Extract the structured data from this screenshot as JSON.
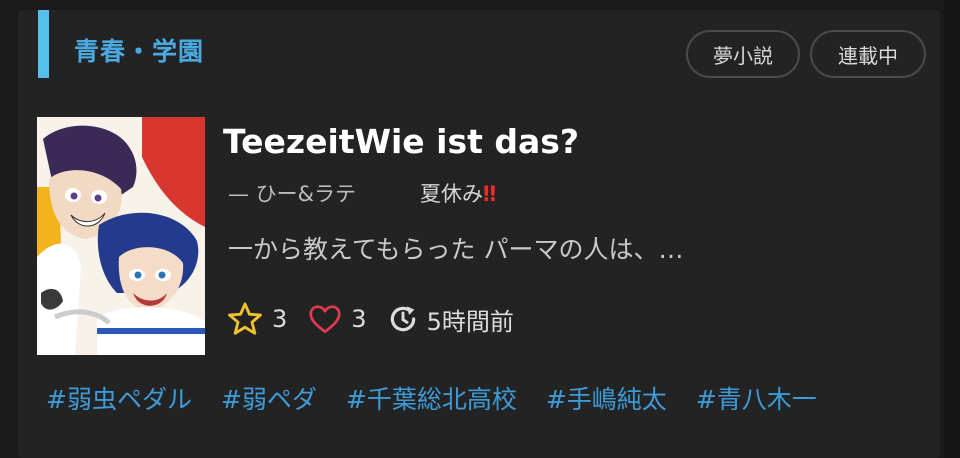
{
  "genre": {
    "label": "青春・学園"
  },
  "badges": {
    "dream": "夢小説",
    "serial": "連載中"
  },
  "story": {
    "title": "TeezeitWie ist das?",
    "author": "— ひー&ラテ",
    "episode": "夏休み",
    "episode_mark": "‼",
    "excerpt": "一から教えてもらった パーマの人は、…"
  },
  "stats": {
    "stars": "3",
    "likes": "3",
    "updated": "5時間前"
  },
  "tags": [
    "#弱虫ペダル",
    "#弱ペダ",
    "#千葉総北高校",
    "#手嶋純太",
    "#青八木一"
  ],
  "colors": {
    "accent_bar": "#56c0ec",
    "tag": "#3d9bd9",
    "star": "#f2c230",
    "heart": "#e23b4e",
    "warning": "#ef2c2c"
  },
  "icons": {
    "star": "star-icon",
    "heart": "heart-icon",
    "clock": "clock-refresh-icon"
  }
}
